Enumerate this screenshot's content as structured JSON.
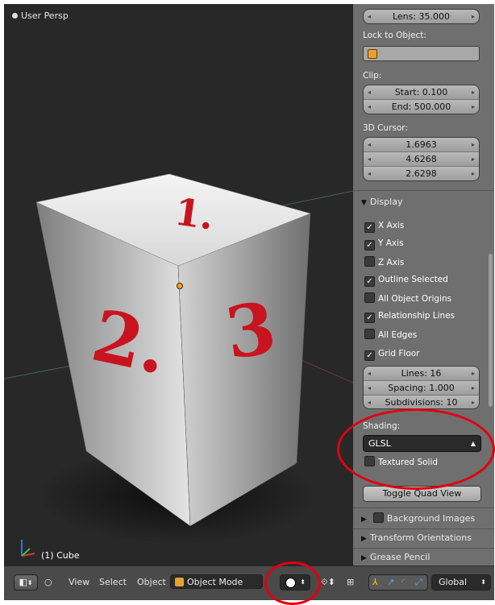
{
  "viewport": {
    "title": "User Persp",
    "object_label": "(1) Cube",
    "cube_faces": [
      "1.",
      "2.",
      "3"
    ]
  },
  "properties": {
    "lens": "Lens: 35.000",
    "lock_to_object_label": "Lock to Object:",
    "clip_label": "Clip:",
    "clip_start": "Start: 0.100",
    "clip_end": "End: 500.000",
    "cursor_label": "3D Cursor:",
    "cursor": [
      "1.6963",
      "4.6268",
      "2.6298"
    ],
    "display_header": "Display",
    "checkboxes": [
      {
        "label": "X Axis",
        "checked": true
      },
      {
        "label": "Y Axis",
        "checked": true
      },
      {
        "label": "Z Axis",
        "checked": false
      },
      {
        "label": "Outline Selected",
        "checked": true
      },
      {
        "label": "All Object Origins",
        "checked": false
      },
      {
        "label": "Relationship Lines",
        "checked": true
      },
      {
        "label": "All Edges",
        "checked": false
      },
      {
        "label": "Grid Floor",
        "checked": true
      }
    ],
    "grid": [
      "Lines: 16",
      "Spacing: 1.000",
      "Subdivisions: 10"
    ],
    "shading_label": "Shading:",
    "shading_value": "GLSL",
    "textured_solid": "Textured Solid",
    "toggle_quad": "Toggle Quad View",
    "collapsed_panels": [
      "Background Images",
      "Transform Orientations",
      "Grease Pencil"
    ]
  },
  "header": {
    "menu_view": "View",
    "menu_select": "Select",
    "menu_object": "Object",
    "mode": "Object Mode",
    "orientation": "Global"
  },
  "colors": {
    "annotation_red": "#e00010",
    "face_marking_red": "#c8141e",
    "mode_icon": "#e8a030"
  }
}
